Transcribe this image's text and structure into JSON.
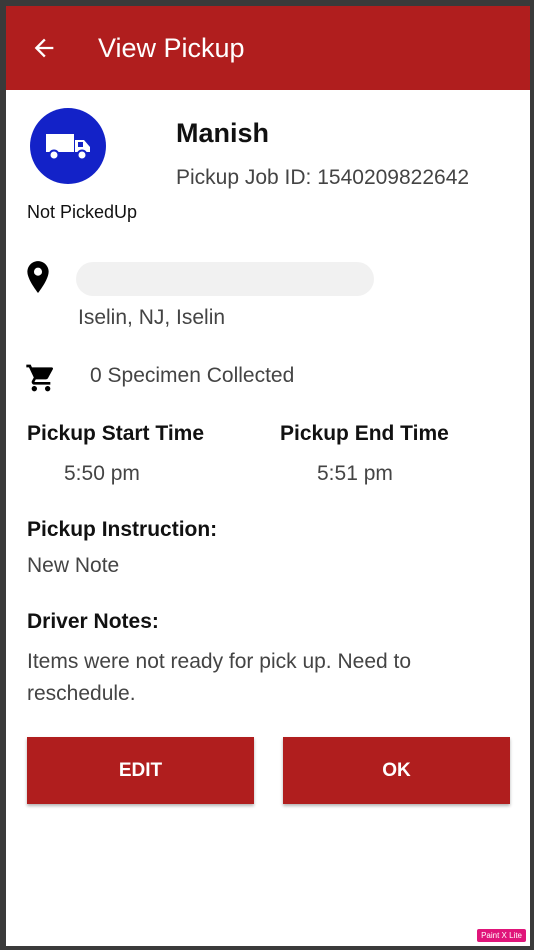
{
  "appbar": {
    "title": "View Pickup",
    "color": "#b01e1e"
  },
  "pickup": {
    "icon": "truck-icon",
    "icon_bg": "#1322c8",
    "status": "Not PickedUp",
    "name": "Manish",
    "job_id_text": "Pickup Job ID: 1540209822642"
  },
  "location": {
    "icon": "location-pin-icon",
    "city": "Iselin, NJ, Iselin"
  },
  "specimen": {
    "icon": "cart-icon",
    "text": "0 Specimen Collected"
  },
  "times": {
    "start_label": "Pickup Start Time",
    "start_value": "5:50 pm",
    "end_label": "Pickup End Time",
    "end_value": "5:51 pm"
  },
  "instruction": {
    "label": "Pickup Instruction:",
    "value": "New Note"
  },
  "driver_notes": {
    "label": "Driver Notes:",
    "value": "Items were not ready for pick up. Need to reschedule."
  },
  "actions": {
    "edit_label": "EDIT",
    "ok_label": "OK"
  },
  "watermark": "Paint X Lite"
}
